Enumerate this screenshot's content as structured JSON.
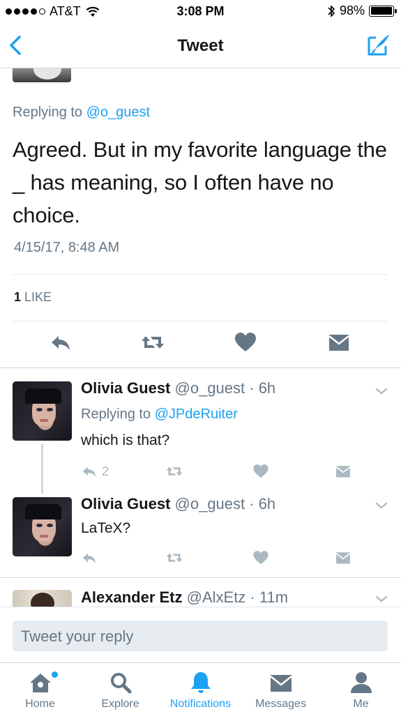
{
  "status_bar": {
    "carrier": "AT&T",
    "time": "3:08 PM",
    "battery": "98%",
    "battery_level": 0.98
  },
  "nav": {
    "title": "Tweet"
  },
  "main_tweet": {
    "replying_prefix": "Replying to",
    "replying_handle": "@o_guest",
    "text": "Agreed. But in my favorite language the _ has meaning, so I often have no choice.",
    "timestamp": "4/15/17, 8:48 AM",
    "likes_count": "1",
    "likes_label": "LIKE"
  },
  "replies": [
    {
      "name": "Olivia Guest",
      "handle_time": "@o_guest · 6h",
      "replying_prefix": "Replying to",
      "replying_handle": "@JPdeRuiter",
      "text": "which is that?",
      "reply_count": "2"
    },
    {
      "name": "Olivia Guest",
      "handle_time": "@o_guest · 6h",
      "text": "LaTeX?"
    },
    {
      "name": "Alexander Etz",
      "handle_time": "@AlxEtz · 11m"
    }
  ],
  "reply_box": {
    "placeholder": "Tweet your reply"
  },
  "tabs": [
    {
      "label": "Home",
      "icon": "home-icon"
    },
    {
      "label": "Explore",
      "icon": "search-icon"
    },
    {
      "label": "Notifications",
      "icon": "bell-icon",
      "active": true
    },
    {
      "label": "Messages",
      "icon": "envelope-icon"
    },
    {
      "label": "Me",
      "icon": "person-icon"
    }
  ],
  "colors": {
    "accent": "#1da1f2",
    "muted": "#657786",
    "icon_gray": "#657786",
    "icon_light": "#aab8c2"
  }
}
